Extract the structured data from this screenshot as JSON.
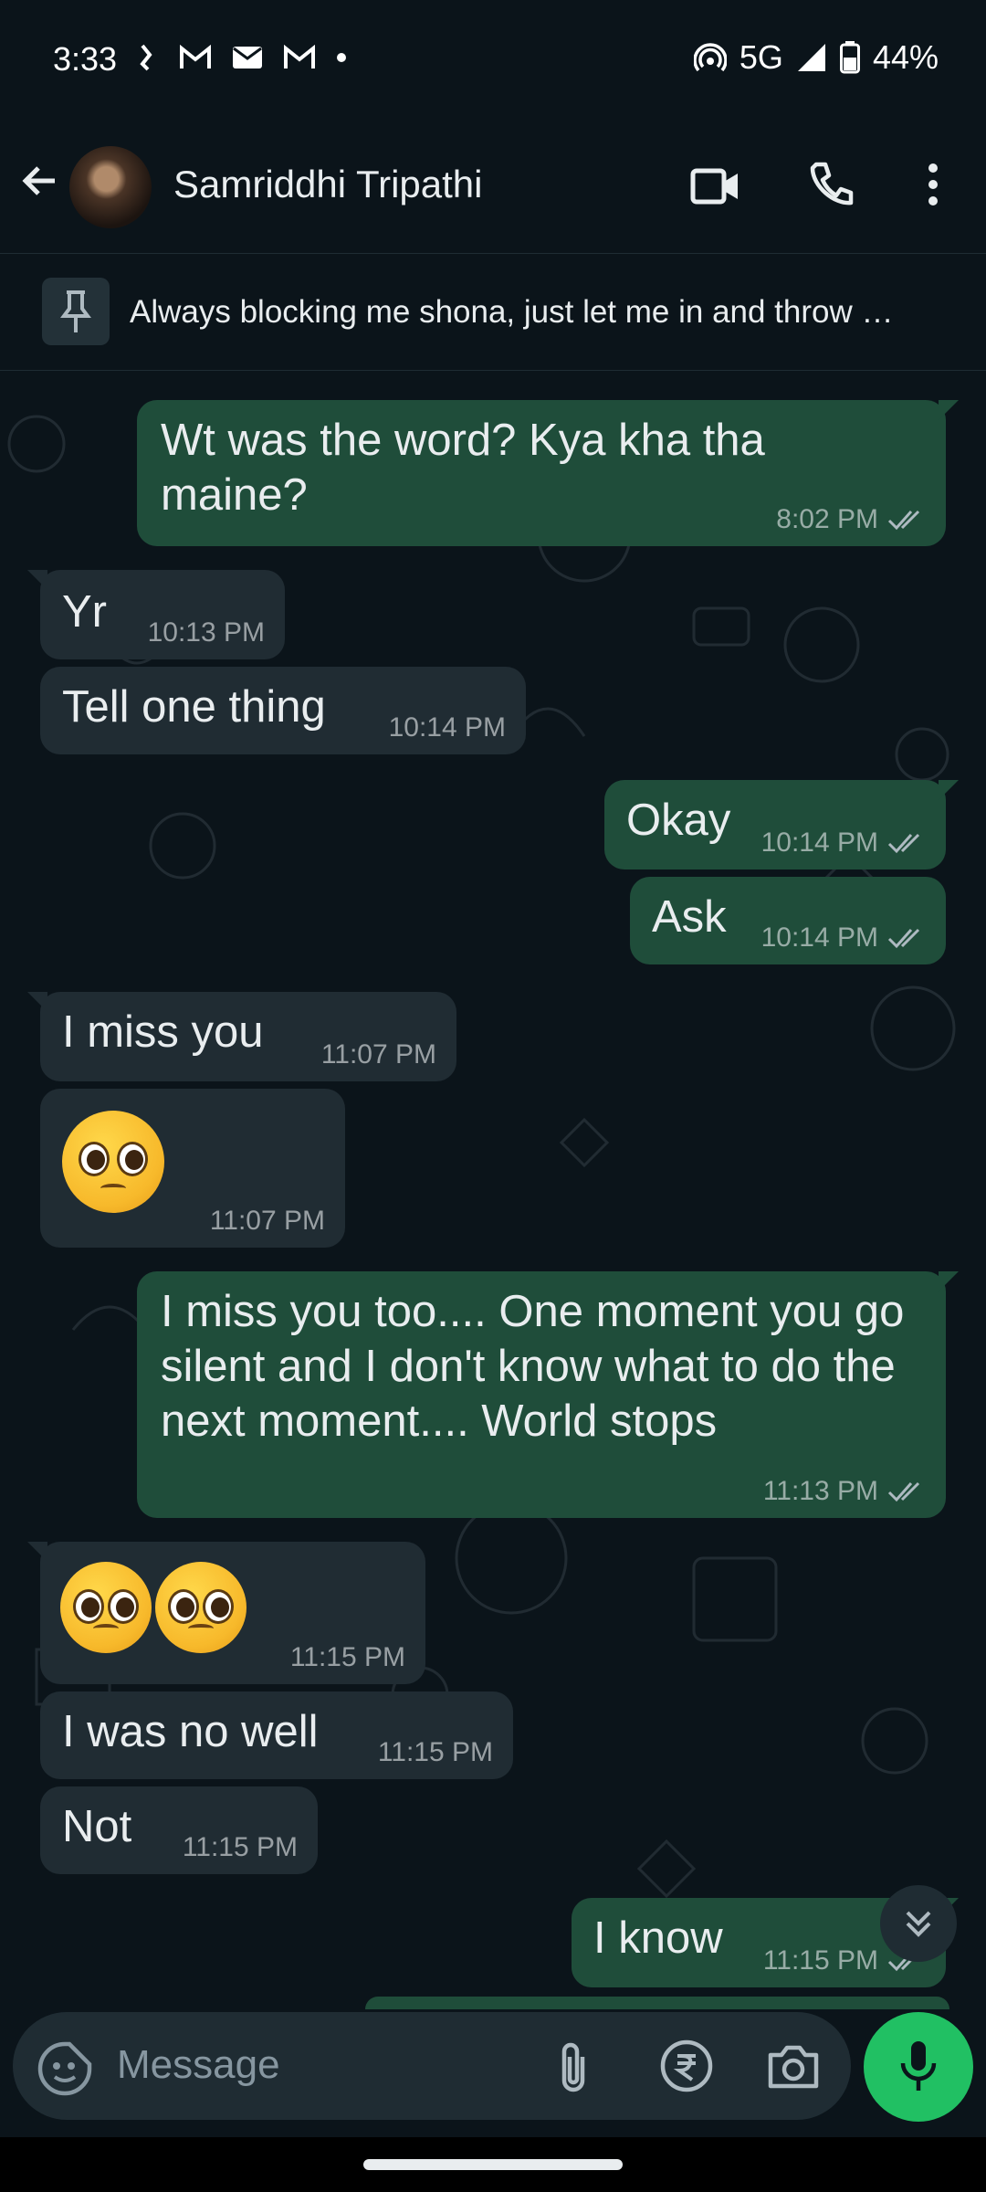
{
  "status_bar": {
    "time": "3:33",
    "network": "5G",
    "battery": "44%"
  },
  "header": {
    "contact_name": "Samriddhi Tripathi"
  },
  "pinned": {
    "text": "Always blocking me shona, just let me in and throw …"
  },
  "messages": [
    {
      "dir": "out",
      "text": "Wt was the word? Kya kha tha maine?",
      "time": "8:02 PM"
    },
    {
      "dir": "in",
      "text": "Yr",
      "time": "10:13 PM"
    },
    {
      "dir": "in",
      "text": "Tell one thing",
      "time": "10:14 PM"
    },
    {
      "dir": "out",
      "text": "Okay",
      "time": "10:14 PM"
    },
    {
      "dir": "out",
      "text": "Ask",
      "time": "10:14 PM"
    },
    {
      "dir": "in",
      "text": "I miss you",
      "time": "11:07 PM"
    },
    {
      "dir": "in",
      "text": "🥺",
      "time": "11:07 PM"
    },
    {
      "dir": "out",
      "text": "I miss you too.... One moment you go silent and I don't know what to do the next moment.... World stops",
      "time": "11:13 PM"
    },
    {
      "dir": "in",
      "text": "🥺🥺",
      "time": "11:15 PM"
    },
    {
      "dir": "in",
      "text": "I was no well",
      "time": "11:15 PM"
    },
    {
      "dir": "in",
      "text": "Not",
      "time": "11:15 PM"
    },
    {
      "dir": "out",
      "text": "I know",
      "time": "11:15 PM"
    }
  ],
  "input": {
    "placeholder": "Message"
  },
  "colors": {
    "background": "#0b141a",
    "incoming_bubble": "#202c33",
    "outgoing_bubble": "#1f4d3a",
    "mic_button": "#21c063"
  }
}
